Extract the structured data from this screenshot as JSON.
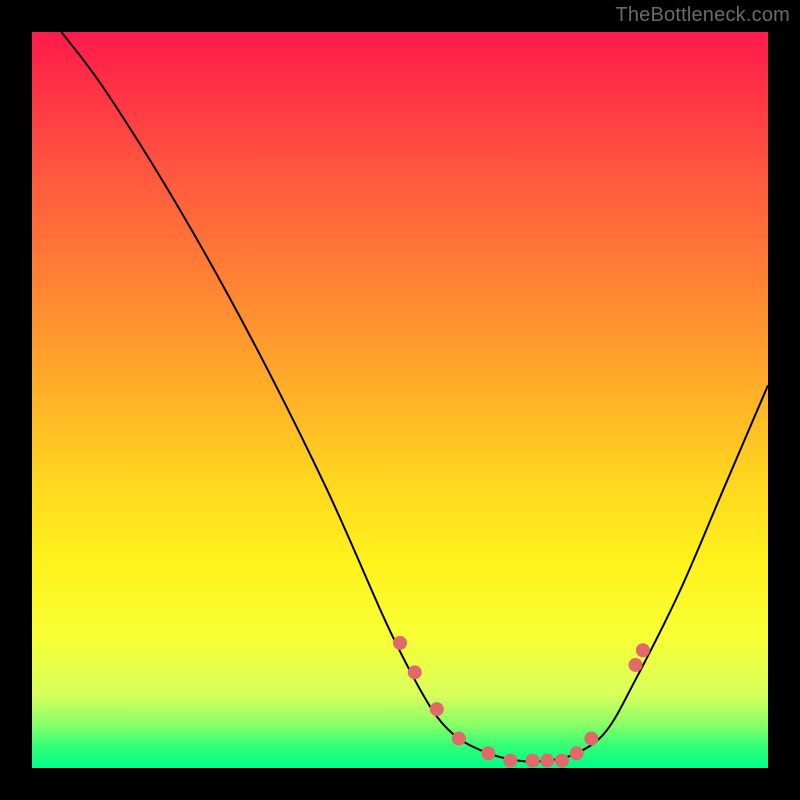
{
  "credit_text": "TheBottleneck.com",
  "chart_data": {
    "type": "line",
    "title": "",
    "xlabel": "",
    "ylabel": "",
    "xlim": [
      0,
      100
    ],
    "ylim": [
      0,
      100
    ],
    "series": [
      {
        "name": "curve",
        "x": [
          4,
          10,
          20,
          30,
          40,
          48,
          52,
          55,
          58,
          62,
          66,
          70,
          74,
          78,
          82,
          88,
          94,
          100
        ],
        "y": [
          100,
          92,
          76,
          58,
          38,
          20,
          12,
          7,
          4,
          2,
          1,
          1,
          2,
          5,
          12,
          24,
          38,
          52
        ]
      }
    ],
    "points": {
      "name": "markers",
      "x": [
        50,
        52,
        55,
        58,
        62,
        65,
        68,
        70,
        72,
        74,
        76,
        82,
        83
      ],
      "y": [
        17,
        13,
        8,
        4,
        2,
        1,
        1,
        1,
        1,
        2,
        4,
        14,
        16
      ]
    }
  }
}
